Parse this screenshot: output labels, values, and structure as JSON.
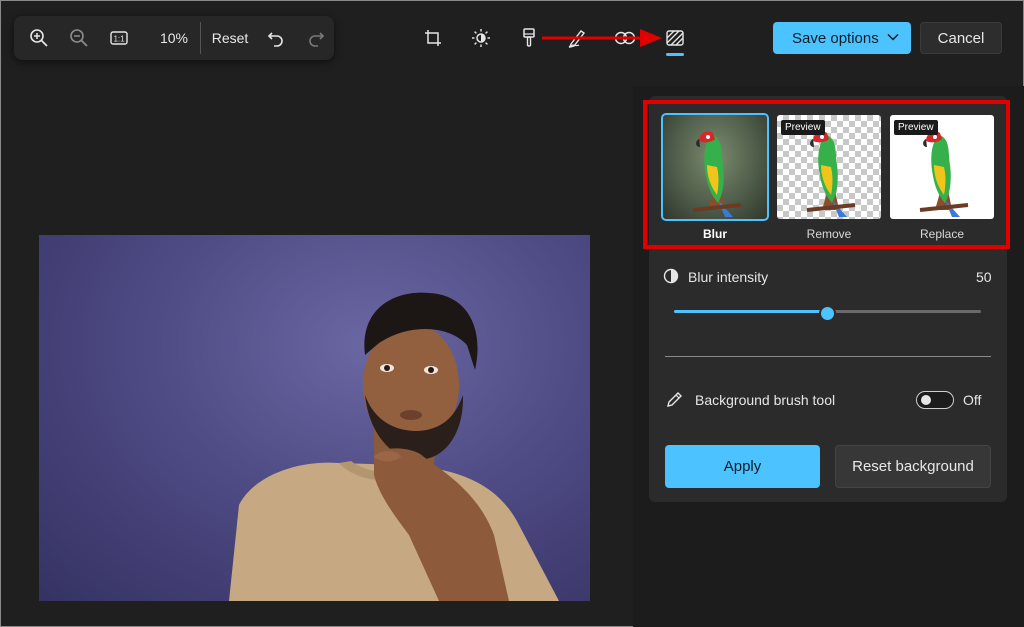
{
  "zoom_toolbar": {
    "zoom_value": "10%",
    "reset_label": "Reset"
  },
  "edit_tools": {
    "items": [
      "crop-icon",
      "brightness-icon",
      "brush-icon",
      "markup-icon",
      "spot-fix-icon",
      "background-icon"
    ],
    "active": "background-icon"
  },
  "header": {
    "save_label": "Save options",
    "cancel_label": "Cancel"
  },
  "panel": {
    "options": [
      {
        "label": "Blur",
        "badge": "",
        "selected": true
      },
      {
        "label": "Remove",
        "badge": "Preview",
        "selected": false
      },
      {
        "label": "Replace",
        "badge": "Preview",
        "selected": false
      }
    ],
    "blur_intensity": {
      "label": "Blur intensity",
      "value": "50",
      "fraction": 0.5
    },
    "brush": {
      "label": "Background brush tool",
      "state": "Off"
    },
    "apply_label": "Apply",
    "reset_background_label": "Reset background"
  },
  "colors": {
    "accent": "#4cc2ff",
    "annotation_red": "#e00000",
    "background": "#1f1f1f"
  }
}
